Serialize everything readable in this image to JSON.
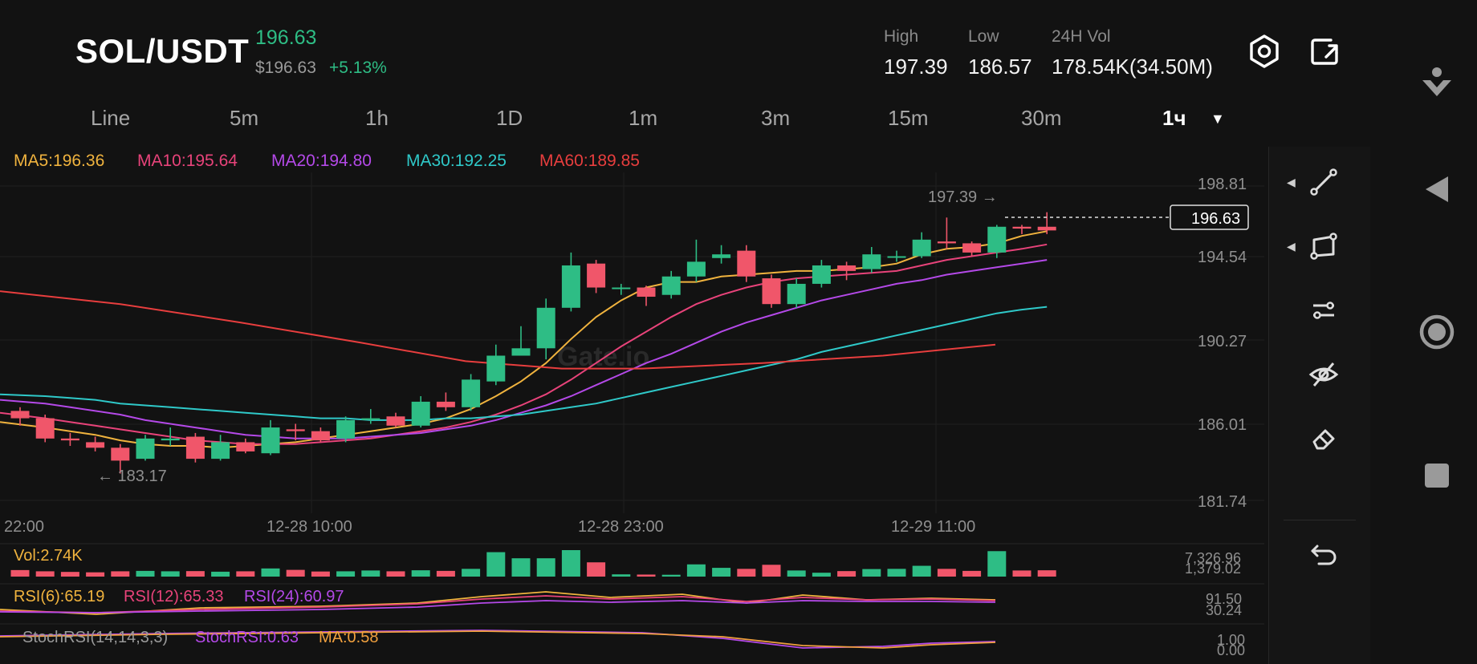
{
  "header": {
    "pair": "SOL/USDT",
    "last_price": "196.63",
    "fiat_price": "$196.63",
    "change_pct": "+5.13%",
    "stats": [
      {
        "label": "High",
        "value": "197.39"
      },
      {
        "label": "Low",
        "value": "186.57"
      },
      {
        "label": "24H Vol",
        "value": "178.54K(34.50M)"
      }
    ],
    "icons": [
      "settings-hexagon-icon",
      "share-icon"
    ]
  },
  "timeframes": [
    "Line",
    "5m",
    "1h",
    "1D",
    "1m",
    "3m",
    "15m",
    "30m"
  ],
  "timeframe_selected": "1ч",
  "ma_legend": [
    {
      "label": "MA5:196.36",
      "color": "#f0b33e"
    },
    {
      "label": "MA10:195.64",
      "color": "#e8437a"
    },
    {
      "label": "MA20:194.80",
      "color": "#b449e8"
    },
    {
      "label": "MA30:192.25",
      "color": "#2fc9c9"
    },
    {
      "label": "MA60:189.85",
      "color": "#e83e3e"
    }
  ],
  "price_axis": [
    "198.81",
    "194.54",
    "190.27",
    "186.01",
    "181.74"
  ],
  "time_axis": [
    "22:00",
    "12-28 10:00",
    "12-28 23:00",
    "12-29 11:00"
  ],
  "current_price_tag": "196.63",
  "high_marker": "197.39 →",
  "low_marker": "← 183.17",
  "watermark": "Gate.io",
  "volume": {
    "label": "Vol:2.74K",
    "max_label": "7,326.96",
    "second_label": "1,379.02"
  },
  "rsi": {
    "labels": [
      {
        "text": "RSI(6):65.19",
        "color": "#f0b33e"
      },
      {
        "text": "RSI(12):65.33",
        "color": "#e8437a"
      },
      {
        "text": "RSI(24):60.97",
        "color": "#b449e8"
      }
    ],
    "axis": [
      "91.50",
      "30.24"
    ]
  },
  "stoch": {
    "labels": [
      {
        "text": "StochRSI(14,14,3,3)",
        "color": "#9a9a9a"
      },
      {
        "text": "StochRSI:0.63",
        "color": "#b449e8"
      },
      {
        "text": "MA:0.58",
        "color": "#f0a03e"
      }
    ],
    "axis": [
      "1.00",
      "0.00"
    ]
  },
  "colors": {
    "up": "#2ebd85",
    "down": "#f0566a",
    "bg": "#121212"
  },
  "right_tools": [
    "trend-line-icon",
    "rectangle-icon",
    "parallel-lines-icon",
    "hide-eye-icon",
    "eraser-icon",
    "undo-icon"
  ],
  "nav_icons": [
    "person-download-icon",
    "back-triangle-icon",
    "home-circle-icon",
    "square-stop-icon"
  ],
  "chart_data": {
    "type": "candlestick",
    "interval": "1h",
    "ylim": [
      181.74,
      198.81
    ],
    "candles": [
      [
        186.6,
        186.2,
        186.8,
        185.8
      ],
      [
        186.2,
        185.1,
        186.4,
        184.9
      ],
      [
        185.1,
        185.0,
        185.4,
        184.7
      ],
      [
        184.9,
        184.6,
        185.2,
        184.4
      ],
      [
        184.6,
        183.9,
        184.8,
        183.2
      ],
      [
        184.0,
        185.1,
        185.3,
        183.9
      ],
      [
        185.0,
        185.1,
        185.7,
        184.7
      ],
      [
        185.2,
        184.0,
        185.4,
        183.8
      ],
      [
        184.0,
        184.9,
        185.3,
        183.9
      ],
      [
        184.9,
        184.4,
        185.1,
        184.3
      ],
      [
        184.3,
        185.7,
        186.1,
        184.2
      ],
      [
        185.6,
        185.5,
        185.9,
        185.0
      ],
      [
        185.5,
        185.0,
        185.7,
        184.9
      ],
      [
        185.1,
        186.1,
        186.3,
        184.9
      ],
      [
        186.1,
        186.2,
        186.7,
        185.9
      ],
      [
        186.3,
        185.8,
        186.5,
        185.7
      ],
      [
        185.8,
        187.1,
        187.4,
        185.7
      ],
      [
        187.1,
        186.8,
        187.6,
        186.6
      ],
      [
        186.8,
        188.3,
        188.6,
        186.6
      ],
      [
        188.2,
        189.6,
        190.2,
        188.0
      ],
      [
        189.6,
        190.0,
        191.2,
        189.8
      ],
      [
        190.0,
        192.2,
        192.7,
        189.4
      ],
      [
        192.2,
        194.5,
        195.2,
        192.0
      ],
      [
        194.6,
        193.3,
        194.8,
        193.0
      ],
      [
        193.3,
        193.3,
        193.5,
        192.9
      ],
      [
        193.3,
        192.8,
        193.4,
        192.3
      ],
      [
        192.9,
        193.9,
        194.2,
        192.7
      ],
      [
        193.9,
        194.7,
        195.9,
        193.6
      ],
      [
        194.9,
        195.1,
        195.6,
        194.6
      ],
      [
        195.3,
        193.9,
        195.6,
        193.6
      ],
      [
        193.8,
        192.4,
        194.0,
        192.2
      ],
      [
        192.4,
        193.5,
        193.8,
        192.2
      ],
      [
        193.5,
        194.5,
        194.8,
        193.3
      ],
      [
        194.5,
        194.2,
        194.7,
        193.7
      ],
      [
        194.3,
        195.1,
        195.5,
        194.1
      ],
      [
        195.0,
        195.0,
        195.3,
        194.7
      ],
      [
        195.0,
        195.9,
        196.3,
        194.9
      ],
      [
        195.8,
        195.7,
        197.1,
        195.4
      ],
      [
        195.7,
        195.2,
        195.8,
        195.0
      ],
      [
        195.2,
        196.6,
        196.7,
        194.9
      ],
      [
        196.6,
        196.5,
        196.7,
        196.2
      ],
      [
        196.6,
        196.4,
        197.39,
        196.2
      ]
    ],
    "volume": [
      320,
      260,
      230,
      210,
      260,
      280,
      260,
      270,
      240,
      260,
      400,
      330,
      250,
      260,
      300,
      260,
      310,
      280,
      380,
      1200,
      900,
      900,
      1300,
      700,
      110,
      100,
      90,
      600,
      430,
      380,
      580,
      300,
      190,
      270,
      370,
      380,
      530,
      380,
      280,
      1250,
      300,
      310
    ],
    "ma": {
      "MA5": [
        186.0,
        185.7,
        185.5,
        185.3,
        185.0,
        184.8,
        184.7,
        184.7,
        184.6,
        184.7,
        184.8,
        184.9,
        185.1,
        185.3,
        185.5,
        185.7,
        185.9,
        186.2,
        186.7,
        187.4,
        188.2,
        189.2,
        190.5,
        191.7,
        192.6,
        193.3,
        193.6,
        193.6,
        193.9,
        194.0,
        194.1,
        194.2,
        194.2,
        194.3,
        194.4,
        194.6,
        195.1,
        195.4,
        195.5,
        195.7,
        196.1,
        196.36
      ],
      "MA10": [
        186.5,
        186.2,
        186.0,
        185.8,
        185.6,
        185.4,
        185.2,
        185.0,
        184.9,
        184.8,
        184.8,
        184.8,
        184.9,
        185.0,
        185.1,
        185.3,
        185.5,
        185.7,
        186.0,
        186.4,
        186.9,
        187.5,
        188.3,
        189.2,
        190.1,
        190.9,
        191.7,
        192.4,
        192.9,
        193.3,
        193.6,
        193.8,
        193.9,
        194.0,
        194.1,
        194.2,
        194.5,
        194.8,
        195.0,
        195.2,
        195.4,
        195.64
      ],
      "MA20": [
        187.2,
        187.0,
        186.8,
        186.6,
        186.4,
        186.1,
        185.9,
        185.7,
        185.5,
        185.3,
        185.2,
        185.1,
        185.1,
        185.1,
        185.2,
        185.3,
        185.4,
        185.6,
        185.8,
        186.1,
        186.5,
        186.9,
        187.4,
        188.0,
        188.6,
        189.2,
        189.7,
        190.3,
        190.9,
        191.4,
        191.8,
        192.2,
        192.6,
        192.9,
        193.2,
        193.5,
        193.7,
        194.0,
        194.2,
        194.4,
        194.6,
        194.8
      ],
      "MA30": [
        187.5,
        187.4,
        187.3,
        187.2,
        187.0,
        186.9,
        186.8,
        186.7,
        186.6,
        186.5,
        186.4,
        186.3,
        186.2,
        186.2,
        186.1,
        186.1,
        186.1,
        186.2,
        186.2,
        186.3,
        186.4,
        186.6,
        186.8,
        187.0,
        187.3,
        187.6,
        187.9,
        188.2,
        188.5,
        188.8,
        189.1,
        189.4,
        189.8,
        190.1,
        190.4,
        190.7,
        191.0,
        191.3,
        191.6,
        191.9,
        192.1,
        192.25
      ]
    }
  }
}
